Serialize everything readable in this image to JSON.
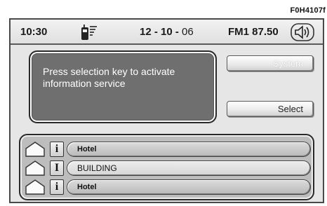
{
  "figure_code": "F0H4107f",
  "status_bar": {
    "time": "10:30",
    "date_main": "12 - 10 - ",
    "date_year": "06",
    "radio": "FM1 87.50",
    "phone_icon": "phone-signal-icon",
    "speaker_icon": "speaker-icon"
  },
  "info_panel": {
    "message": "Press selection key to activate information service"
  },
  "buttons": {
    "system_label": "System",
    "select_label": "Select"
  },
  "list": {
    "rows": [
      {
        "category_icon": "i",
        "label": "Hotel"
      },
      {
        "category_icon": "I",
        "label": "BUILDING"
      },
      {
        "category_icon": "i",
        "label": "Hotel"
      }
    ]
  },
  "colors": {
    "info_panel_bg": "#6f6f6f",
    "screen_bg": "#e6e6e6",
    "list_panel_bg": "#bdbdbd"
  }
}
